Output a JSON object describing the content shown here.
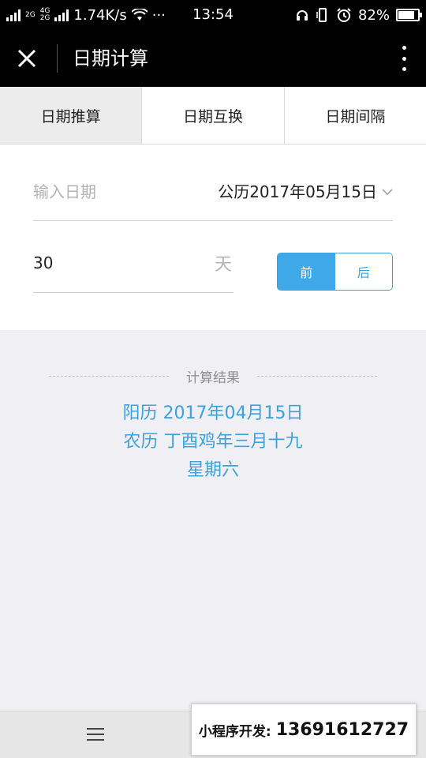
{
  "status_bar": {
    "network_label_top": "2G",
    "network_label_mid": "4G",
    "network_label_bot": "2G",
    "speed": "1.74K/s",
    "more": "···",
    "time": "13:54",
    "battery": "82%",
    "battery_level": 0.82
  },
  "nav": {
    "title": "日期计算",
    "close_icon": "close-icon",
    "more_icon": "more-vertical-icon"
  },
  "tabs": [
    {
      "label": "日期推算",
      "active": true
    },
    {
      "label": "日期互换",
      "active": false
    },
    {
      "label": "日期间隔",
      "active": false
    }
  ],
  "form": {
    "date_label": "输入日期",
    "date_value": "公历2017年05月15日",
    "days_value": "30",
    "days_unit": "天",
    "direction_options": [
      "前",
      "后"
    ],
    "direction_selected": "前"
  },
  "result": {
    "heading": "计算结果",
    "solar": "阳历 2017年04月15日",
    "lunar": "农历 丁酉鸡年三月十九",
    "weekday": "星期六"
  },
  "bottom": {
    "menu_icon": "menu-icon",
    "promo_label": "小程序开发:",
    "promo_phone": "13691612727"
  },
  "colors": {
    "accent": "#3fa8e8",
    "result_text": "#3aa3de",
    "navbar": "#000000",
    "page_bg": "#efeff4"
  }
}
